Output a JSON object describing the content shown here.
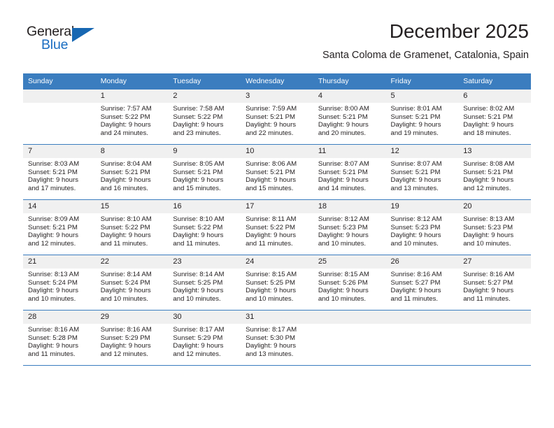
{
  "brand": {
    "name_part1": "General",
    "name_part2": "Blue",
    "flag_color": "#1767b2"
  },
  "header": {
    "month_title": "December 2025",
    "location": "Santa Coloma de Gramenet, Catalonia, Spain",
    "header_bg": "#3b7dbf",
    "daynum_bg": "#f0f0f0"
  },
  "weekdays": [
    "Sunday",
    "Monday",
    "Tuesday",
    "Wednesday",
    "Thursday",
    "Friday",
    "Saturday"
  ],
  "weeks": [
    [
      {
        "day": "",
        "blank": true
      },
      {
        "day": "1",
        "sunrise": "Sunrise: 7:57 AM",
        "sunset": "Sunset: 5:22 PM",
        "daylight_line1": "Daylight: 9 hours",
        "daylight_line2": "and 24 minutes."
      },
      {
        "day": "2",
        "sunrise": "Sunrise: 7:58 AM",
        "sunset": "Sunset: 5:22 PM",
        "daylight_line1": "Daylight: 9 hours",
        "daylight_line2": "and 23 minutes."
      },
      {
        "day": "3",
        "sunrise": "Sunrise: 7:59 AM",
        "sunset": "Sunset: 5:21 PM",
        "daylight_line1": "Daylight: 9 hours",
        "daylight_line2": "and 22 minutes."
      },
      {
        "day": "4",
        "sunrise": "Sunrise: 8:00 AM",
        "sunset": "Sunset: 5:21 PM",
        "daylight_line1": "Daylight: 9 hours",
        "daylight_line2": "and 20 minutes."
      },
      {
        "day": "5",
        "sunrise": "Sunrise: 8:01 AM",
        "sunset": "Sunset: 5:21 PM",
        "daylight_line1": "Daylight: 9 hours",
        "daylight_line2": "and 19 minutes."
      },
      {
        "day": "6",
        "sunrise": "Sunrise: 8:02 AM",
        "sunset": "Sunset: 5:21 PM",
        "daylight_line1": "Daylight: 9 hours",
        "daylight_line2": "and 18 minutes."
      }
    ],
    [
      {
        "day": "7",
        "sunrise": "Sunrise: 8:03 AM",
        "sunset": "Sunset: 5:21 PM",
        "daylight_line1": "Daylight: 9 hours",
        "daylight_line2": "and 17 minutes."
      },
      {
        "day": "8",
        "sunrise": "Sunrise: 8:04 AM",
        "sunset": "Sunset: 5:21 PM",
        "daylight_line1": "Daylight: 9 hours",
        "daylight_line2": "and 16 minutes."
      },
      {
        "day": "9",
        "sunrise": "Sunrise: 8:05 AM",
        "sunset": "Sunset: 5:21 PM",
        "daylight_line1": "Daylight: 9 hours",
        "daylight_line2": "and 15 minutes."
      },
      {
        "day": "10",
        "sunrise": "Sunrise: 8:06 AM",
        "sunset": "Sunset: 5:21 PM",
        "daylight_line1": "Daylight: 9 hours",
        "daylight_line2": "and 15 minutes."
      },
      {
        "day": "11",
        "sunrise": "Sunrise: 8:07 AM",
        "sunset": "Sunset: 5:21 PM",
        "daylight_line1": "Daylight: 9 hours",
        "daylight_line2": "and 14 minutes."
      },
      {
        "day": "12",
        "sunrise": "Sunrise: 8:07 AM",
        "sunset": "Sunset: 5:21 PM",
        "daylight_line1": "Daylight: 9 hours",
        "daylight_line2": "and 13 minutes."
      },
      {
        "day": "13",
        "sunrise": "Sunrise: 8:08 AM",
        "sunset": "Sunset: 5:21 PM",
        "daylight_line1": "Daylight: 9 hours",
        "daylight_line2": "and 12 minutes."
      }
    ],
    [
      {
        "day": "14",
        "sunrise": "Sunrise: 8:09 AM",
        "sunset": "Sunset: 5:21 PM",
        "daylight_line1": "Daylight: 9 hours",
        "daylight_line2": "and 12 minutes."
      },
      {
        "day": "15",
        "sunrise": "Sunrise: 8:10 AM",
        "sunset": "Sunset: 5:22 PM",
        "daylight_line1": "Daylight: 9 hours",
        "daylight_line2": "and 11 minutes."
      },
      {
        "day": "16",
        "sunrise": "Sunrise: 8:10 AM",
        "sunset": "Sunset: 5:22 PM",
        "daylight_line1": "Daylight: 9 hours",
        "daylight_line2": "and 11 minutes."
      },
      {
        "day": "17",
        "sunrise": "Sunrise: 8:11 AM",
        "sunset": "Sunset: 5:22 PM",
        "daylight_line1": "Daylight: 9 hours",
        "daylight_line2": "and 11 minutes."
      },
      {
        "day": "18",
        "sunrise": "Sunrise: 8:12 AM",
        "sunset": "Sunset: 5:23 PM",
        "daylight_line1": "Daylight: 9 hours",
        "daylight_line2": "and 10 minutes."
      },
      {
        "day": "19",
        "sunrise": "Sunrise: 8:12 AM",
        "sunset": "Sunset: 5:23 PM",
        "daylight_line1": "Daylight: 9 hours",
        "daylight_line2": "and 10 minutes."
      },
      {
        "day": "20",
        "sunrise": "Sunrise: 8:13 AM",
        "sunset": "Sunset: 5:23 PM",
        "daylight_line1": "Daylight: 9 hours",
        "daylight_line2": "and 10 minutes."
      }
    ],
    [
      {
        "day": "21",
        "sunrise": "Sunrise: 8:13 AM",
        "sunset": "Sunset: 5:24 PM",
        "daylight_line1": "Daylight: 9 hours",
        "daylight_line2": "and 10 minutes."
      },
      {
        "day": "22",
        "sunrise": "Sunrise: 8:14 AM",
        "sunset": "Sunset: 5:24 PM",
        "daylight_line1": "Daylight: 9 hours",
        "daylight_line2": "and 10 minutes."
      },
      {
        "day": "23",
        "sunrise": "Sunrise: 8:14 AM",
        "sunset": "Sunset: 5:25 PM",
        "daylight_line1": "Daylight: 9 hours",
        "daylight_line2": "and 10 minutes."
      },
      {
        "day": "24",
        "sunrise": "Sunrise: 8:15 AM",
        "sunset": "Sunset: 5:25 PM",
        "daylight_line1": "Daylight: 9 hours",
        "daylight_line2": "and 10 minutes."
      },
      {
        "day": "25",
        "sunrise": "Sunrise: 8:15 AM",
        "sunset": "Sunset: 5:26 PM",
        "daylight_line1": "Daylight: 9 hours",
        "daylight_line2": "and 10 minutes."
      },
      {
        "day": "26",
        "sunrise": "Sunrise: 8:16 AM",
        "sunset": "Sunset: 5:27 PM",
        "daylight_line1": "Daylight: 9 hours",
        "daylight_line2": "and 11 minutes."
      },
      {
        "day": "27",
        "sunrise": "Sunrise: 8:16 AM",
        "sunset": "Sunset: 5:27 PM",
        "daylight_line1": "Daylight: 9 hours",
        "daylight_line2": "and 11 minutes."
      }
    ],
    [
      {
        "day": "28",
        "sunrise": "Sunrise: 8:16 AM",
        "sunset": "Sunset: 5:28 PM",
        "daylight_line1": "Daylight: 9 hours",
        "daylight_line2": "and 11 minutes."
      },
      {
        "day": "29",
        "sunrise": "Sunrise: 8:16 AM",
        "sunset": "Sunset: 5:29 PM",
        "daylight_line1": "Daylight: 9 hours",
        "daylight_line2": "and 12 minutes."
      },
      {
        "day": "30",
        "sunrise": "Sunrise: 8:17 AM",
        "sunset": "Sunset: 5:29 PM",
        "daylight_line1": "Daylight: 9 hours",
        "daylight_line2": "and 12 minutes."
      },
      {
        "day": "31",
        "sunrise": "Sunrise: 8:17 AM",
        "sunset": "Sunset: 5:30 PM",
        "daylight_line1": "Daylight: 9 hours",
        "daylight_line2": "and 13 minutes."
      },
      {
        "day": "",
        "blank": true
      },
      {
        "day": "",
        "blank": true
      },
      {
        "day": "",
        "blank": true
      }
    ]
  ]
}
